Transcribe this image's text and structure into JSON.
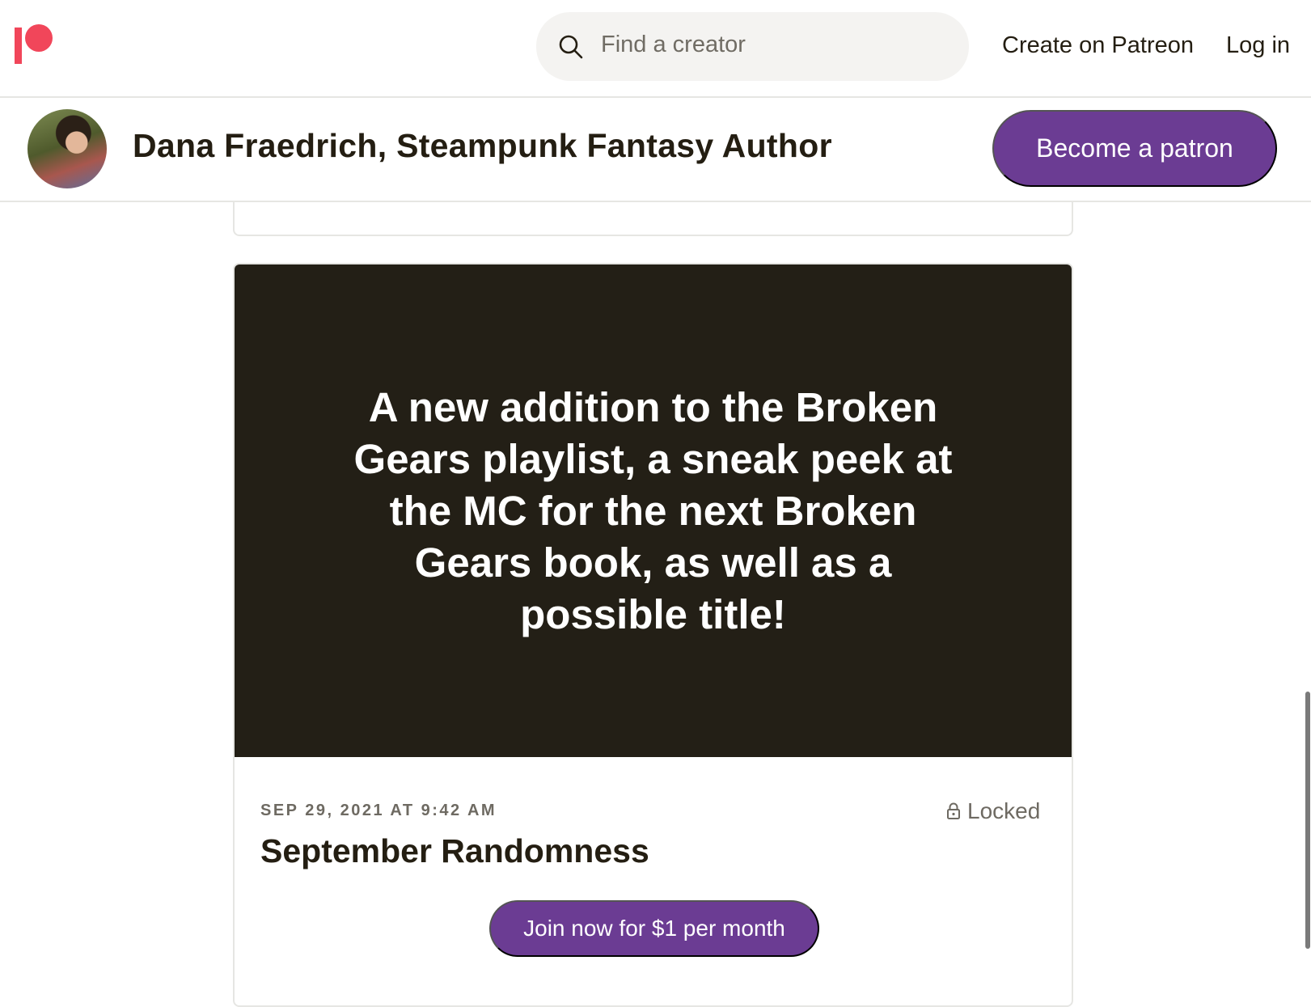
{
  "nav": {
    "search_placeholder": "Find a creator",
    "create_link": "Create on Patreon",
    "login_link": "Log in"
  },
  "creator": {
    "name": "Dana Fraedrich, Steampunk Fantasy Author",
    "become_patron_label": "Become a patron"
  },
  "post": {
    "teaser_text": "A new addition to the Broken Gears playlist, a sneak peek at the MC for the next Broken Gears book, as well as a possible title!",
    "date": "SEP 29, 2021 AT 9:42 AM",
    "lock_status": "Locked",
    "title": "September Randomness",
    "join_label": "Join now for $1 per month"
  },
  "colors": {
    "brand_red": "#f1465a",
    "button_purple": "#6b3c93",
    "post_image_bg": "#231f16"
  },
  "icons": [
    "patreon-logo",
    "search-icon",
    "lock-icon"
  ]
}
